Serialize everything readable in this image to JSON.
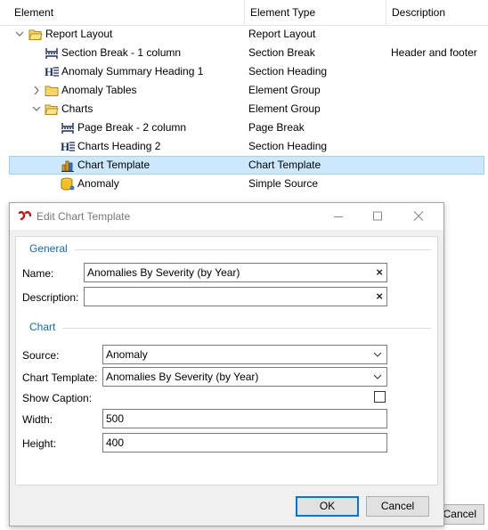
{
  "columns": {
    "element": "Element",
    "type": "Element Type",
    "description": "Description"
  },
  "tree": [
    {
      "label": "Report Layout",
      "type": "Report Layout",
      "description": "",
      "icon": "folder-open-icon"
    },
    {
      "label": "Section Break - 1 column",
      "type": "Section Break",
      "description": "Header and footer",
      "icon": "section-break-icon"
    },
    {
      "label": "Anomaly Summary Heading 1",
      "type": "Section Heading",
      "description": "",
      "icon": "heading-icon"
    },
    {
      "label": "Anomaly Tables",
      "type": "Element Group",
      "description": "",
      "icon": "folder-icon"
    },
    {
      "label": "Charts",
      "type": "Element Group",
      "description": "",
      "icon": "folder-open-icon"
    },
    {
      "label": "Page Break - 2 column",
      "type": "Page Break",
      "description": "",
      "icon": "page-break-icon"
    },
    {
      "label": "Charts Heading 2",
      "type": "Section Heading",
      "description": "",
      "icon": "heading-icon"
    },
    {
      "label": "Chart Template",
      "type": "Chart Template",
      "description": "",
      "icon": "bar-chart-icon"
    },
    {
      "label": "Anomaly",
      "type": "Simple Source",
      "description": "",
      "icon": "database-icon"
    }
  ],
  "background_cancel": "Cancel",
  "dialog": {
    "title": "Edit Chart Template",
    "general_section": "General",
    "name_label": "Name:",
    "name_value": "Anomalies By Severity (by Year)",
    "description_label": "Description:",
    "description_value": "",
    "chart_section": "Chart",
    "source_label": "Source:",
    "source_value": "Anomaly",
    "template_label": "Chart Template:",
    "template_value": "Anomalies By Severity (by Year)",
    "caption_label": "Show Caption:",
    "show_caption": false,
    "width_label": "Width:",
    "width_value": "500",
    "height_label": "Height:",
    "height_value": "400",
    "ok": "OK",
    "cancel": "Cancel",
    "clear_glyph": "×"
  }
}
